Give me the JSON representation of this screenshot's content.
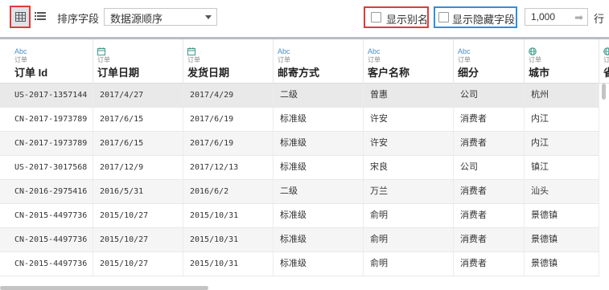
{
  "toolbar": {
    "grid_icon": "grid-icon",
    "list_icon": "list-icon",
    "sort_label": "排序字段",
    "sort_value": "数据源顺序",
    "show_alias_label": "显示别名",
    "show_hidden_label": "显示隐藏字段",
    "rows_value": "1,000",
    "rows_label": "行",
    "alias_highlight_color": "#e03b3b",
    "hidden_highlight_color": "#2f8ee0"
  },
  "columns": [
    {
      "type": "Abc",
      "source": "订单",
      "name": "订单 Id"
    },
    {
      "type": "calendar",
      "source": "订单",
      "name": "订单日期"
    },
    {
      "type": "calendar",
      "source": "订单",
      "name": "发货日期"
    },
    {
      "type": "Abc",
      "source": "订单",
      "name": "邮寄方式"
    },
    {
      "type": "Abc",
      "source": "订单",
      "name": "客户名称"
    },
    {
      "type": "Abc",
      "source": "订单",
      "name": "细分"
    },
    {
      "type": "globe",
      "source": "订单",
      "name": "城市"
    },
    {
      "type": "globe",
      "source": "订单",
      "name": "省"
    }
  ],
  "rows": [
    [
      "US-2017-1357144",
      "2017/4/27",
      "2017/4/29",
      "二级",
      "曾惠",
      "公司",
      "杭州"
    ],
    [
      "CN-2017-1973789",
      "2017/6/15",
      "2017/6/19",
      "标准级",
      "许安",
      "消费者",
      "内江"
    ],
    [
      "CN-2017-1973789",
      "2017/6/15",
      "2017/6/19",
      "标准级",
      "许安",
      "消费者",
      "内江"
    ],
    [
      "US-2017-3017568",
      "2017/12/9",
      "2017/12/13",
      "标准级",
      "宋良",
      "公司",
      "镇江"
    ],
    [
      "CN-2016-2975416",
      "2016/5/31",
      "2016/6/2",
      "二级",
      "万兰",
      "消费者",
      "汕头"
    ],
    [
      "CN-2015-4497736",
      "2015/10/27",
      "2015/10/31",
      "标准级",
      "俞明",
      "消费者",
      "景德镇"
    ],
    [
      "CN-2015-4497736",
      "2015/10/27",
      "2015/10/31",
      "标准级",
      "俞明",
      "消费者",
      "景德镇"
    ],
    [
      "CN-2015-4497736",
      "2015/10/27",
      "2015/10/31",
      "标准级",
      "俞明",
      "消费者",
      "景德镇"
    ]
  ]
}
